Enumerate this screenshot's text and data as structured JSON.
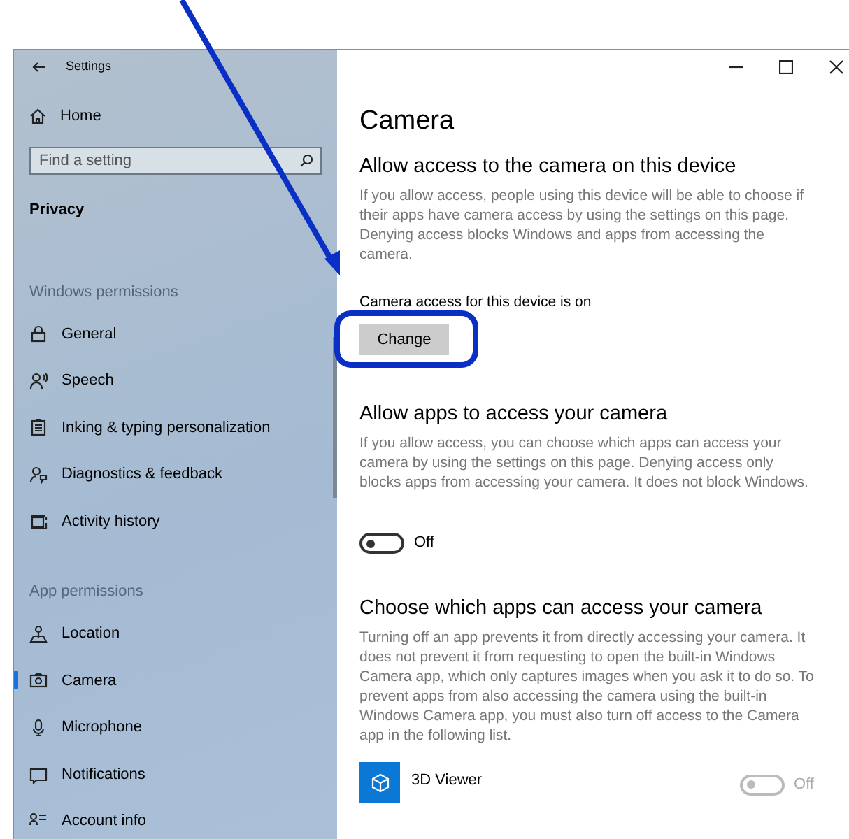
{
  "window": {
    "title": "Settings"
  },
  "sidebar": {
    "home": "Home",
    "search": {
      "placeholder": "Find a setting"
    },
    "section": "Privacy",
    "groups": [
      {
        "heading": "Windows permissions",
        "items": [
          {
            "label": "General",
            "selected": false
          },
          {
            "label": "Speech",
            "selected": false
          },
          {
            "label": "Inking & typing personalization",
            "selected": false
          },
          {
            "label": "Diagnostics & feedback",
            "selected": false
          },
          {
            "label": "Activity history",
            "selected": false
          }
        ]
      },
      {
        "heading": "App permissions",
        "items": [
          {
            "label": "Location",
            "selected": false
          },
          {
            "label": "Camera",
            "selected": true
          },
          {
            "label": "Microphone",
            "selected": false
          },
          {
            "label": "Notifications",
            "selected": false
          },
          {
            "label": "Account info",
            "selected": false
          }
        ]
      }
    ]
  },
  "content": {
    "title": "Camera",
    "sections": [
      {
        "kind": "status",
        "heading": "Allow access to the camera on this device",
        "text": "If you allow access, people using this device will be able to choose if their apps have camera access by using the settings on this page. Denying access blocks Windows and apps from accessing the camera.",
        "status": "Camera access for this device is on",
        "button": "Change"
      },
      {
        "kind": "toggle",
        "heading": "Allow apps to access your camera",
        "text": "If you allow access, you can choose which apps can access your camera by using the settings on this page. Denying access only blocks apps from accessing your camera. It does not block Windows.",
        "toggle": {
          "on": false,
          "label": "Off"
        }
      },
      {
        "kind": "apps",
        "heading": "Choose which apps can access your camera",
        "text": "Turning off an app prevents it from directly accessing your camera. It does not prevent it from requesting to open the built-in Windows Camera app, which only captures images when you ask it to do so. To prevent apps from also accessing the camera using the built-in Windows Camera app, you must also turn off access to the Camera app in the following list.",
        "apps": [
          {
            "name": "3D Viewer",
            "on": false,
            "disabled": true,
            "label": "Off"
          }
        ]
      }
    ]
  }
}
